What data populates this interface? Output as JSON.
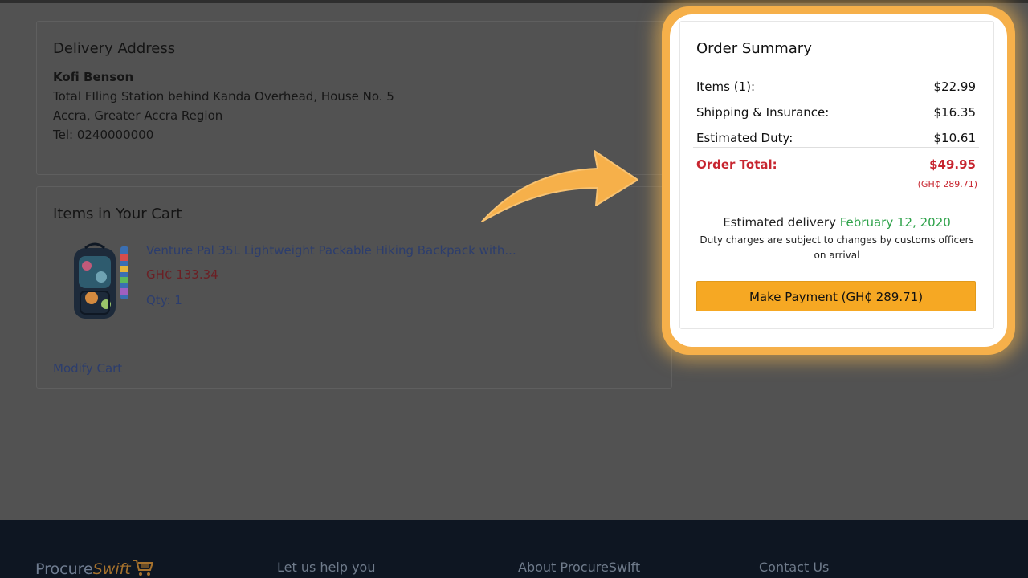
{
  "delivery": {
    "title": "Delivery Address",
    "name": "Kofi Benson",
    "address_line1": "Total FIling Station behind Kanda Overhead, House No. 5",
    "address_line2": "Accra, Greater Accra Region",
    "phone": "Tel: 0240000000"
  },
  "cart": {
    "title": "Items in Your Cart",
    "item": {
      "name": "Venture Pal 35L Lightweight Packable Hiking Backpack with...",
      "price": "GH₵ 133.34",
      "qty": "Qty: 1"
    },
    "modify_label": "Modify Cart"
  },
  "summary": {
    "title": "Order Summary",
    "rows": [
      {
        "label": "Items (1):",
        "value": "$22.99"
      },
      {
        "label": "Shipping & Insurance:",
        "value": "$16.35"
      },
      {
        "label": "Estimated Duty:",
        "value": "$10.61"
      }
    ],
    "total_label": "Order Total:",
    "total_value": "$49.95",
    "total_local": "(GH₵ 289.71)",
    "delivery_prefix": "Estimated delivery",
    "delivery_date": "February 12, 2020",
    "duty_note": "Duty charges are subject to changes by customs officers on arrival",
    "pay_button": "Make Payment (GH₵ 289.71)"
  },
  "footer": {
    "logo_part1": "Procure",
    "logo_part2": "Swift",
    "col1": "Let us help you",
    "col2": "About ProcureSwift",
    "col3": "Contact Us"
  },
  "colors": {
    "overlay": "#525252",
    "accent_orange": "#f6a823",
    "total_red": "#c7252f",
    "delivery_green": "#2ea24a",
    "footer_bg": "#0e1622"
  },
  "icons": [
    "backpack-image",
    "highlight-arrow-icon",
    "shopping-cart-icon"
  ]
}
